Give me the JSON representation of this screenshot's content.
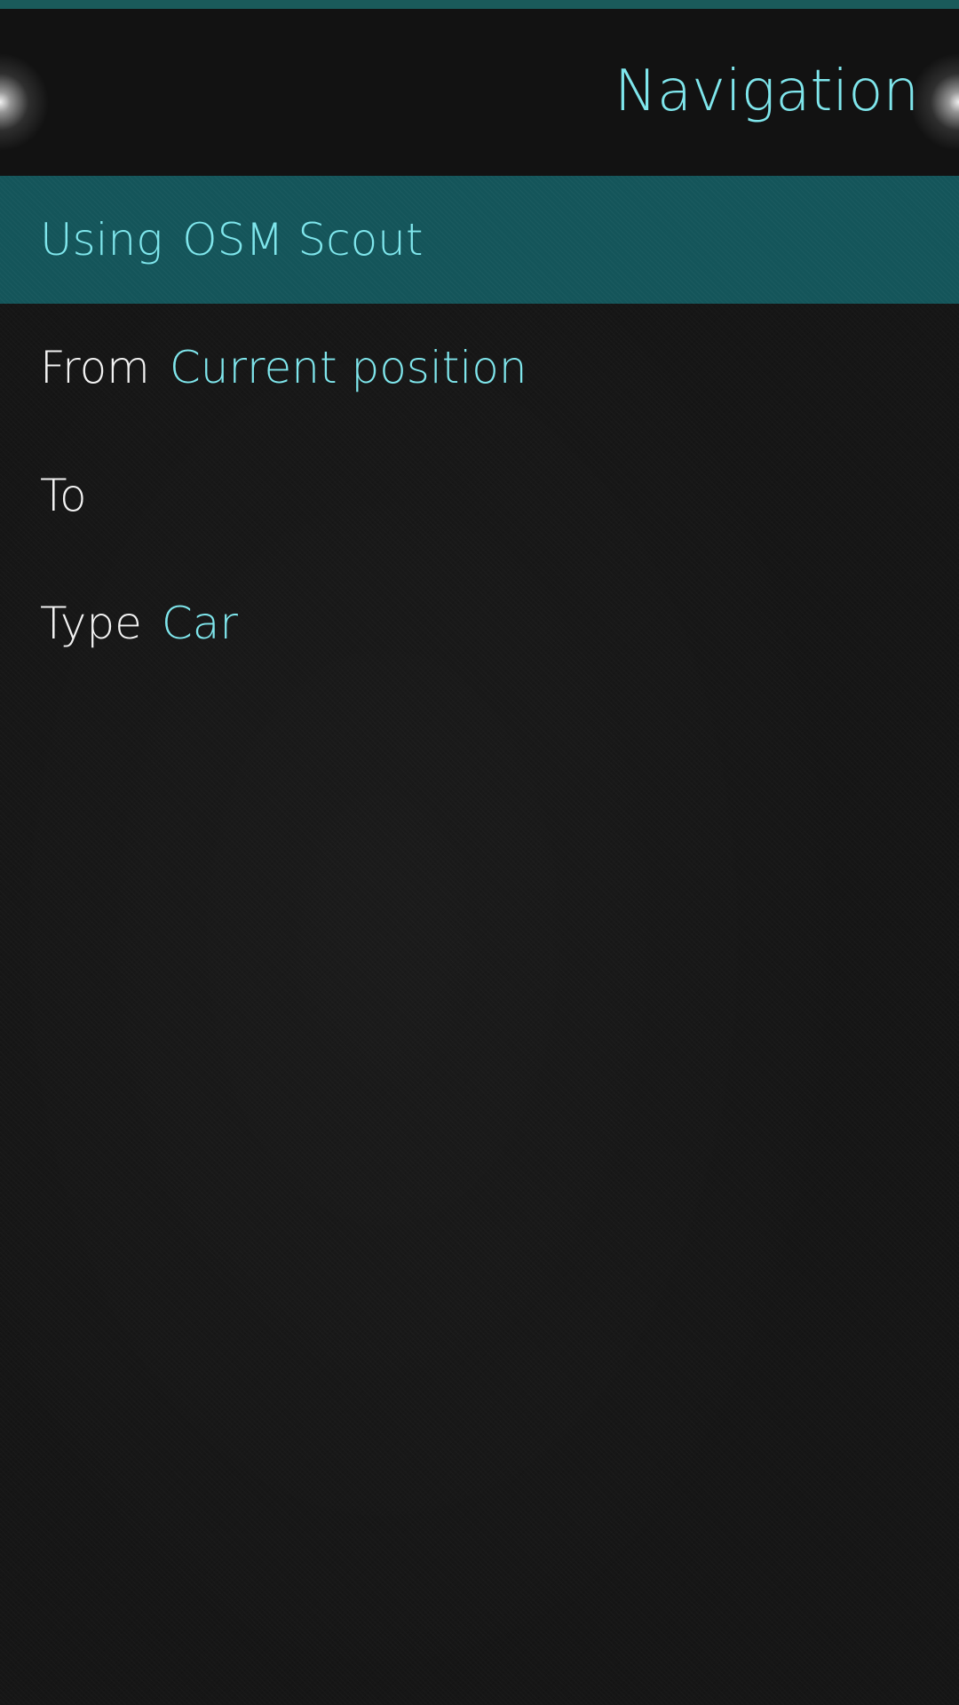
{
  "colors": {
    "accent": "#7fe6ec",
    "highlight_bg": "#14555a",
    "background": "#161616",
    "label_text": "#f2f2f2"
  },
  "header": {
    "title": "Navigation"
  },
  "rows": {
    "using": {
      "label": "Using",
      "value": "OSM Scout"
    },
    "from": {
      "label": "From",
      "value": "Current position"
    },
    "to": {
      "label": "To",
      "value": ""
    },
    "type": {
      "label": "Type",
      "value": "Car"
    }
  }
}
